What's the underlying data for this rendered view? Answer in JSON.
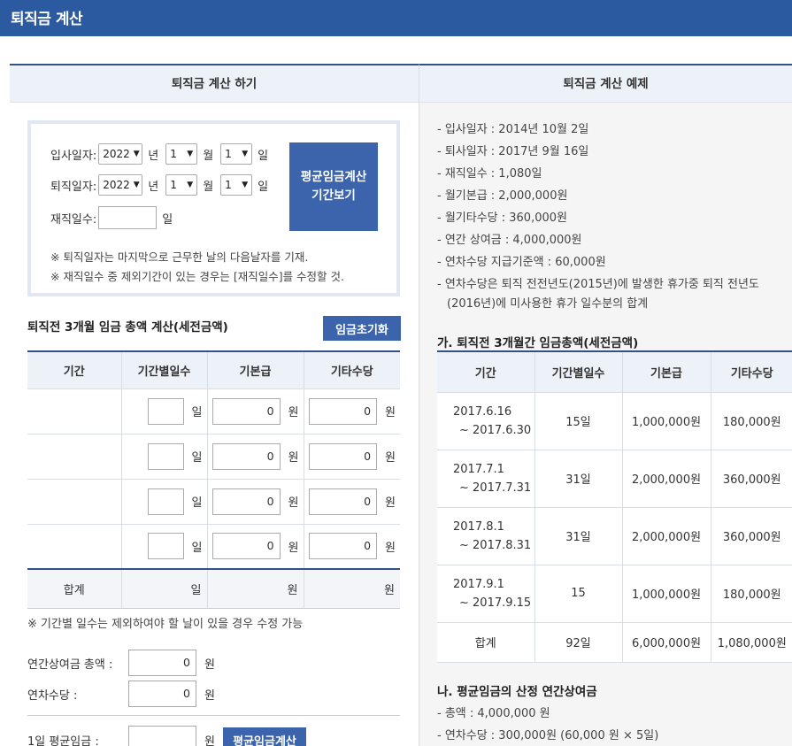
{
  "header": {
    "title": "퇴직금 계산"
  },
  "calc": {
    "heading": "퇴직금 계산 하기",
    "hire_label": "입사일자:",
    "leave_label": "퇴직일자:",
    "days_label": "재직일수:",
    "year_value": "2022",
    "month_value": "1",
    "day_value": "1",
    "year_unit": "년",
    "month_unit": "월",
    "day_unit": "일",
    "period_button_line1": "평균임금계산",
    "period_button_line2": "기간보기",
    "note1": "※ 퇴직일자는 마지막으로 근무한 날의 다음날자를 기재.",
    "note2": "※ 재직일수 중 제외기간이 있는 경우는 [재직일수]를 수정할 것.",
    "wage_title": "퇴직전 3개월 임금 총액 계산(세전금액)",
    "reset_button": "임금초기화",
    "columns": [
      "기간",
      "기간별일수",
      "기본급",
      "기타수당"
    ],
    "rows": [
      {
        "days_unit": "일",
        "basic": "0",
        "basic_unit": "원",
        "extra": "0",
        "extra_unit": "원"
      },
      {
        "days_unit": "일",
        "basic": "0",
        "basic_unit": "원",
        "extra": "0",
        "extra_unit": "원"
      },
      {
        "days_unit": "일",
        "basic": "0",
        "basic_unit": "원",
        "extra": "0",
        "extra_unit": "원"
      },
      {
        "days_unit": "일",
        "basic": "0",
        "basic_unit": "원",
        "extra": "0",
        "extra_unit": "원"
      }
    ],
    "sum": {
      "label": "합계",
      "days": "일",
      "basic": "원",
      "extra": "원"
    },
    "days_note": "※ 기간별 일수는 제외하여야 할 날이 있을 경우 수정 가능",
    "bonus_label": "연간상여금 총액 :",
    "bonus_value": "0",
    "bonus_unit": "원",
    "leave_pay_label": "연차수당 :",
    "leave_pay_value": "0",
    "leave_pay_unit": "원",
    "avg_label": "1일 평균임금 :",
    "avg_unit": "원",
    "avg_button": "평균임금계산"
  },
  "example": {
    "heading": "퇴직금 계산 예제",
    "facts": [
      "- 입사일자 : 2014년 10월 2일",
      "- 퇴사일자 : 2017년 9월 16일",
      "- 재직일수 : 1,080일",
      "- 월기본급 : 2,000,000원",
      "- 월기타수당 : 360,000원",
      "- 연간 상여금 : 4,000,000원",
      "- 연차수당 지급기준액 : 60,000원"
    ],
    "fact_long": "- 연차수당은 퇴직 전전년도(2015년)에 발생한 휴가중 퇴직 전년도(2016년)에 미사용한 휴가 일수분의 합계",
    "table_title": "가. 퇴직전 3개월간 임금총액(세전금액)",
    "columns": [
      "기간",
      "기간별일수",
      "기본급",
      "기타수당"
    ],
    "rows": [
      {
        "p1": "2017.6.16",
        "p2": "~ 2017.6.30",
        "days": "15일",
        "basic": "1,000,000원",
        "extra": "180,000원"
      },
      {
        "p1": "2017.7.1",
        "p2": "~ 2017.7.31",
        "days": "31일",
        "basic": "2,000,000원",
        "extra": "360,000원"
      },
      {
        "p1": "2017.8.1",
        "p2": "~ 2017.8.31",
        "days": "31일",
        "basic": "2,000,000원",
        "extra": "360,000원"
      },
      {
        "p1": "2017.9.1",
        "p2": "~ 2017.9.15",
        "days": "15",
        "basic": "1,000,000원",
        "extra": "180,000원"
      }
    ],
    "sum": {
      "label": "합계",
      "days": "92일",
      "basic": "6,000,000원",
      "extra": "1,080,000원"
    },
    "bonus_title": "나. 평균임금의 산정 연간상여금",
    "bonus_items": [
      "- 총액 : 4,000,000 원",
      "- 연차수당 : 300,000원 (60,000 원 × 5일)"
    ]
  }
}
